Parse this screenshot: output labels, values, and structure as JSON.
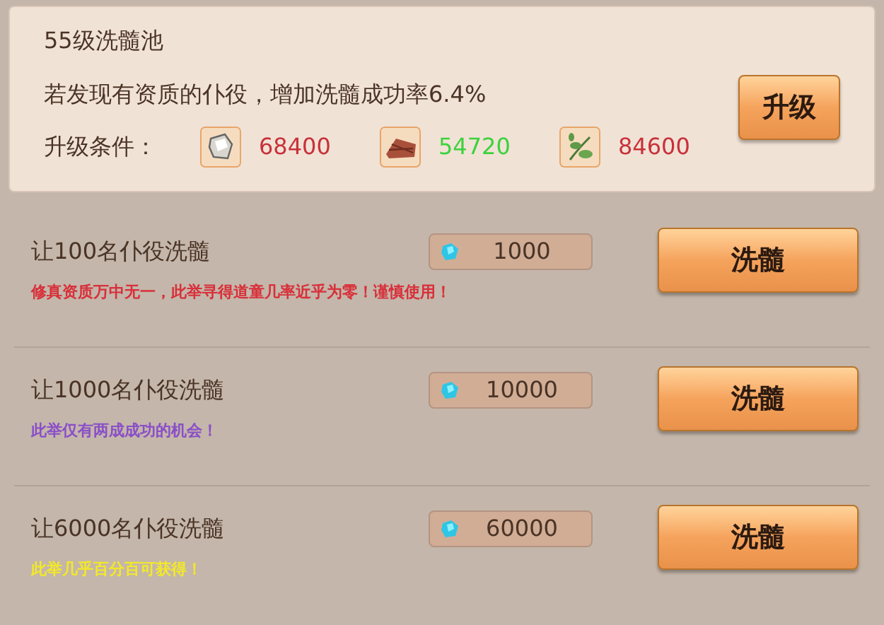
{
  "pool": {
    "title": "55级洗髓池",
    "description": "若发现有资质的仆役，增加洗髓成功率6.4%",
    "conditions_label": "升级条件：",
    "resources": [
      {
        "kind": "stone",
        "amount": "68400",
        "enough": false
      },
      {
        "kind": "wood",
        "amount": "54720",
        "enough": true
      },
      {
        "kind": "herb",
        "amount": "84600",
        "enough": false
      }
    ],
    "upgrade_button": "升级"
  },
  "options": [
    {
      "label": "让100名仆役洗髓",
      "cost": "1000",
      "button": "洗髓",
      "hint": "修真资质万中无一，此举寻得道童几率近乎为零！谨慎使用！",
      "color": "#d8303a"
    },
    {
      "label": "让1000名仆役洗髓",
      "cost": "10000",
      "button": "洗髓",
      "hint": "此举仅有两成成功的机会！",
      "color": "#8a4fc8"
    },
    {
      "label": "让6000名仆役洗髓",
      "cost": "60000",
      "button": "洗髓",
      "hint": "此举几乎百分百可获得！",
      "color": "#f2e82a"
    }
  ]
}
